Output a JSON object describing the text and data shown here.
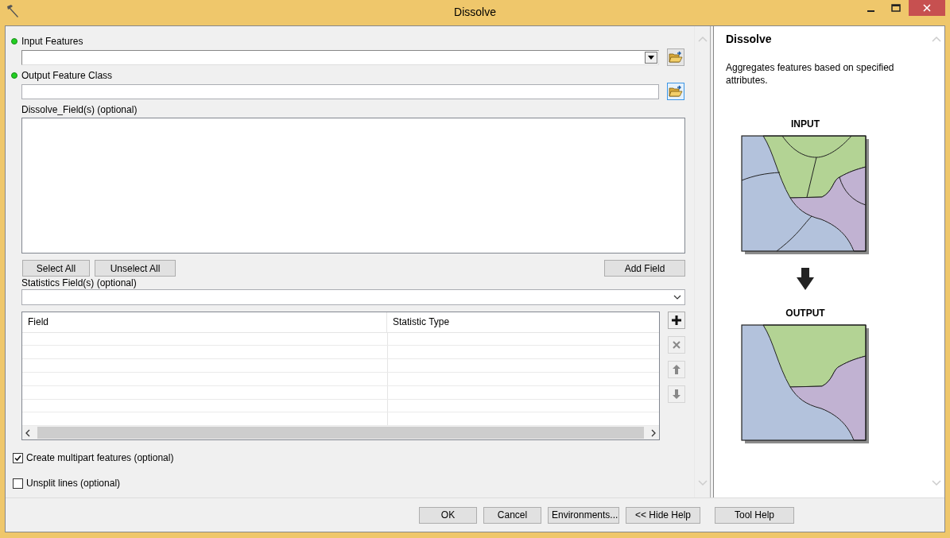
{
  "window": {
    "title": "Dissolve"
  },
  "form": {
    "input_features": {
      "label": "Input Features",
      "required": true
    },
    "output_feature_class": {
      "label": "Output Feature Class",
      "required": true
    },
    "dissolve_fields": {
      "label": "Dissolve_Field(s) (optional)"
    },
    "field_buttons": [
      "Select All",
      "Unselect All"
    ],
    "add_field_button": "Add Field",
    "statistics_fields": {
      "label": "Statistics Field(s) (optional)"
    },
    "table": {
      "columns": [
        "Field",
        "Statistic Type"
      ]
    },
    "table_tools": [
      {
        "kind": "add",
        "disabled": false
      },
      {
        "kind": "remove",
        "disabled": true
      },
      {
        "kind": "up",
        "disabled": true
      },
      {
        "kind": "down",
        "disabled": true
      }
    ],
    "options": [
      {
        "label": "Create multipart features (optional)",
        "checked": true
      },
      {
        "label": "Unsplit lines (optional)",
        "checked": false
      }
    ]
  },
  "help": {
    "title": "Dissolve",
    "description": "Aggregates features based on specified attributes.",
    "input_label": "INPUT",
    "output_label": "OUTPUT"
  },
  "footer_buttons": [
    "OK",
    "Cancel",
    "Environments...",
    "<< Hide Help"
  ],
  "tool_help_button": "Tool Help"
}
